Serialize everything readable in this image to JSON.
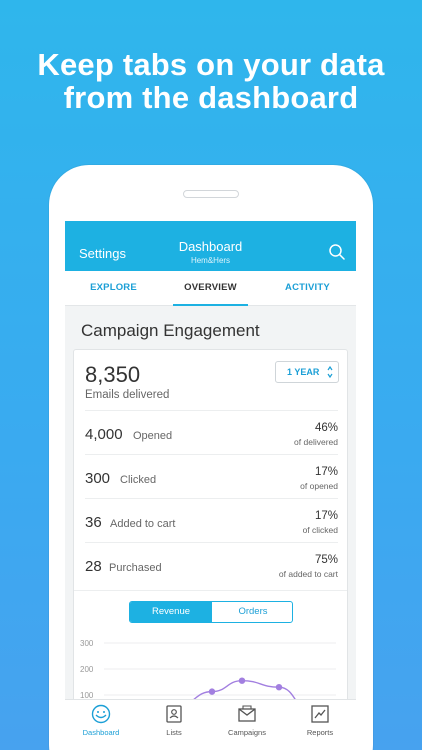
{
  "headline": {
    "line1": "Keep tabs on your data",
    "line2": "from the dashboard"
  },
  "appbar": {
    "left_label": "Settings",
    "title": "Dashboard",
    "subtitle": "Hem&Hers"
  },
  "tabs": [
    {
      "label": "EXPLORE",
      "active": false
    },
    {
      "label": "OVERVIEW",
      "active": true
    },
    {
      "label": "ACTIVITY",
      "active": false
    }
  ],
  "section_title": "Campaign Engagement",
  "summary": {
    "value": "8,350",
    "label": "Emails delivered",
    "period": "1 YEAR"
  },
  "metrics": [
    {
      "value": "4,000",
      "label": "Opened",
      "percent": "46%",
      "of": "of delivered"
    },
    {
      "value": "300",
      "label": "Clicked",
      "percent": "17%",
      "of": "of opened"
    },
    {
      "value": "36",
      "label": "Added to cart",
      "percent": "17%",
      "of": "of clicked"
    },
    {
      "value": "28",
      "label": "Purchased",
      "percent": "75%",
      "of": "of added to cart"
    }
  ],
  "toggle": {
    "on": "Revenue",
    "off": "Orders"
  },
  "chart_data": {
    "type": "line",
    "ytick_labels": [
      "300",
      "200",
      "100"
    ],
    "ylim": [
      0,
      300
    ],
    "series": [
      {
        "values": [
          60,
          113,
          155,
          130,
          20
        ]
      }
    ],
    "grid": true,
    "color": "#a27fe0"
  },
  "bottom_nav": [
    {
      "label": "Dashboard",
      "icon": "dashboard-icon",
      "active": true
    },
    {
      "label": "Lists",
      "icon": "lists-icon",
      "active": false
    },
    {
      "label": "Campaigns",
      "icon": "campaigns-icon",
      "active": false
    },
    {
      "label": "Reports",
      "icon": "reports-icon",
      "active": false
    }
  ],
  "colors": {
    "brand": "#1db1e2",
    "background": "#3aaaf0"
  }
}
